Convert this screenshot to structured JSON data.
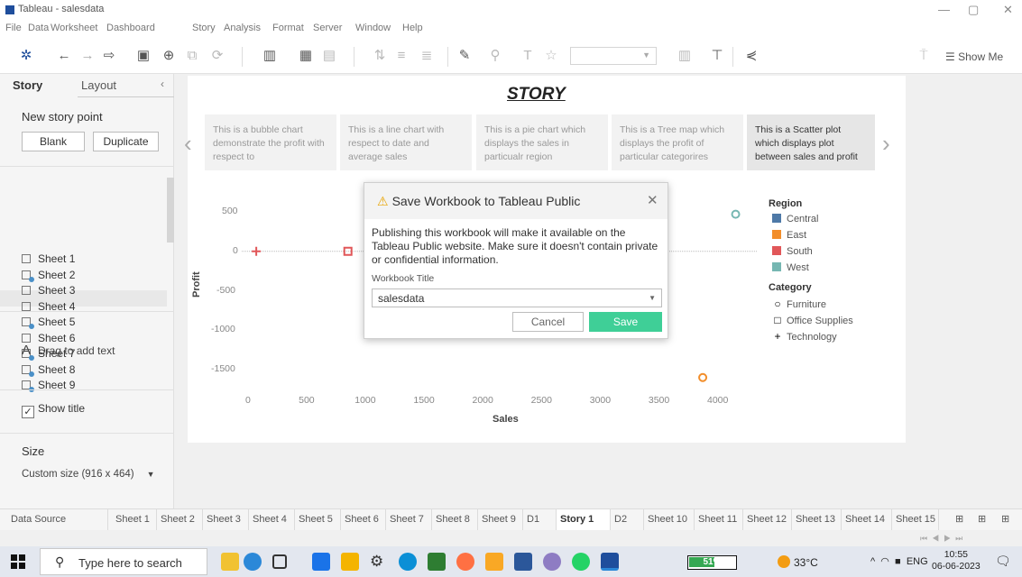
{
  "window": {
    "title": "Tableau - salesdata",
    "minimize": "—",
    "maximize": "▢",
    "close": "✕"
  },
  "menu": [
    "File",
    "Data",
    "Worksheet",
    "Dashboard",
    "Story",
    "Analysis",
    "Format",
    "Server",
    "Window",
    "Help"
  ],
  "toolbar": {
    "show_me": "Show Me"
  },
  "left_pane": {
    "tab_story": "Story",
    "tab_layout": "Layout",
    "collapse": "‹",
    "new_story_point": "New story point",
    "blank_button": "Blank",
    "duplicate_button": "Duplicate",
    "sheets": [
      "Sheet 1",
      "Sheet 2",
      "Sheet 3",
      "Sheet 4",
      "Sheet 5",
      "Sheet 6",
      "Sheet 7",
      "Sheet 8",
      "Sheet 9"
    ],
    "sheets_published": [
      false,
      true,
      false,
      false,
      true,
      false,
      true,
      true,
      true
    ],
    "drag_text_icon": "A",
    "drag_text": "Drag to add text",
    "show_title_check": "✓",
    "show_title": "Show title",
    "size_label": "Size",
    "size_value": "Custom size (916 x 464)"
  },
  "story": {
    "title": "STORY",
    "prev": "‹",
    "next": "›",
    "points": [
      "This is a bubble chart demonstrate the profit with respect to",
      "This is a line chart with respect to date and average sales",
      "This is a pie chart which displays the sales in particualr region",
      "This is a Tree map which displays the profit of particular categorires",
      "This is a Scatter plot which displays plot between sales and profit"
    ]
  },
  "chart_data": {
    "type": "scatter",
    "xlabel": "Sales",
    "ylabel": "Profit",
    "xlim": [
      0,
      4150
    ],
    "ylim": [
      -1700,
      650
    ],
    "x_ticks": [
      "0",
      "500",
      "1000",
      "1500",
      "2000",
      "2500",
      "3000",
      "3500",
      "4000"
    ],
    "y_ticks": [
      "500",
      "0",
      "-500",
      "-1000",
      "-1500"
    ],
    "zero_line": true,
    "points": [
      {
        "x": 70,
        "y": 0,
        "region": "South",
        "category": "Technology"
      },
      {
        "x": 850,
        "y": 0,
        "region": "South",
        "category": "Office Supplies"
      },
      {
        "x": 4150,
        "y": 470,
        "region": "West",
        "category": "Furniture"
      },
      {
        "x": 3870,
        "y": -1600,
        "region": "East",
        "category": "Furniture"
      }
    ],
    "legend": {
      "region_title": "Region",
      "regions": [
        {
          "name": "Central",
          "color": "#4e79a7"
        },
        {
          "name": "East",
          "color": "#f28e2b"
        },
        {
          "name": "South",
          "color": "#e15759"
        },
        {
          "name": "West",
          "color": "#76b7b2"
        }
      ],
      "category_title": "Category",
      "categories": [
        {
          "name": "Furniture",
          "shape": "○"
        },
        {
          "name": "Office Supplies",
          "shape": "□"
        },
        {
          "name": "Technology",
          "shape": "+"
        }
      ],
      "placement": "right"
    }
  },
  "dialog": {
    "warning_icon": "⚠",
    "title": "Save Workbook to Tableau Public",
    "close": "✕",
    "message": "Publishing this workbook will make it available on the Tableau Public website. Make sure it doesn't contain private or confidential information.",
    "field_label": "Workbook Title",
    "field_value": "salesdata",
    "cancel": "Cancel",
    "save": "Save"
  },
  "sheet_tabs": {
    "data_source": "Data Source",
    "tabs": [
      "Sheet 1",
      "Sheet 2",
      "Sheet 3",
      "Sheet 4",
      "Sheet 5",
      "Sheet 6",
      "Sheet 7",
      "Sheet 8",
      "Sheet 9",
      "D1",
      "Story 1",
      "D2",
      "Sheet 10",
      "Sheet 11",
      "Sheet 12",
      "Sheet 13",
      "Sheet 14",
      "Sheet 15"
    ],
    "active": "Story 1"
  },
  "taskbar": {
    "search_placeholder": "Type here to search",
    "battery": "51%",
    "temperature": "33°C",
    "language": "ENG",
    "time": "10:55",
    "date": "06-06-2023"
  },
  "colors": {
    "accent_save": "#3fcf97",
    "warning": "#e8a400"
  }
}
